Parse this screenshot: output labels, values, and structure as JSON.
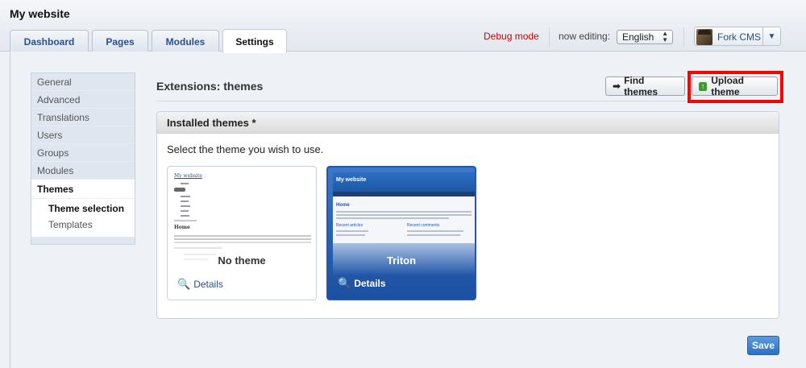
{
  "header": {
    "site_title": "My website",
    "tabs": [
      {
        "label": "Dashboard"
      },
      {
        "label": "Pages"
      },
      {
        "label": "Modules"
      },
      {
        "label": "Settings"
      }
    ],
    "debug_label": "Debug mode",
    "editing_label": "now editing:",
    "language": "English",
    "user_name": "Fork CMS",
    "icons": {
      "lang_arrows": "up-down-arrows",
      "user_menu": "chevron-down-icon"
    }
  },
  "sidebar": {
    "items": [
      {
        "label": "General"
      },
      {
        "label": "Advanced"
      },
      {
        "label": "Translations"
      },
      {
        "label": "Users"
      },
      {
        "label": "Groups"
      },
      {
        "label": "Modules"
      },
      {
        "label": "Themes"
      }
    ],
    "subitems": [
      {
        "label": "Theme selection"
      },
      {
        "label": "Templates"
      }
    ]
  },
  "main": {
    "title": "Extensions: themes",
    "find_themes_label": "Find themes",
    "upload_theme_label": "Upload theme",
    "panel_title": "Installed themes *",
    "panel_instruction": "Select the theme you wish to use.",
    "themes": [
      {
        "name": "No theme",
        "details_label": "Details",
        "preview": {
          "site_title": "My website",
          "heading": "Home"
        }
      },
      {
        "name": "Triton",
        "details_label": "Details",
        "preview": {
          "site_title": "My website",
          "heading": "Home",
          "col1": "Recent articles",
          "col2": "Recent comments"
        }
      }
    ],
    "save_label": "Save"
  },
  "colors": {
    "accent": "#2a4f8f",
    "debug": "#cc0000",
    "highlight_box": "#ff0000",
    "selected_theme": "#2a56a8",
    "save_button": "#2d6fc4"
  }
}
